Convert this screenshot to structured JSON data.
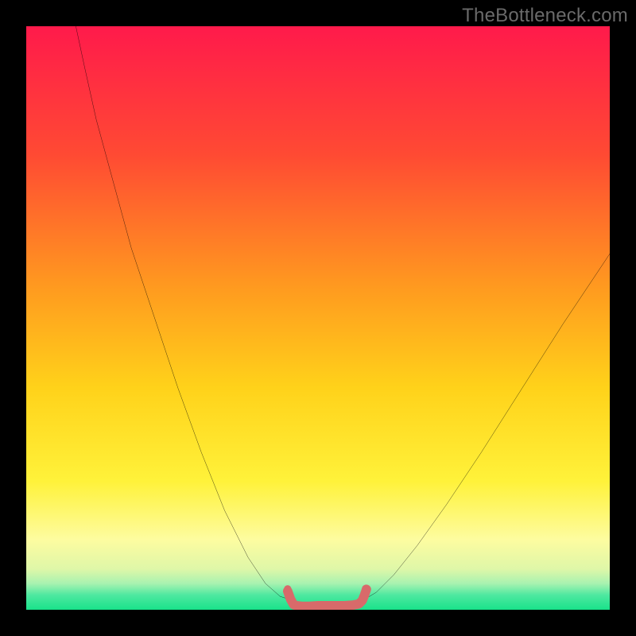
{
  "watermark": "TheBottleneck.com",
  "chart_data": {
    "type": "line",
    "title": "",
    "xlabel": "",
    "ylabel": "",
    "xlim": [
      0,
      100
    ],
    "ylim": [
      0,
      100
    ],
    "grid": false,
    "legend": false,
    "background_gradient_stops": [
      {
        "offset": 0.0,
        "color": "#ff1a4b"
      },
      {
        "offset": 0.22,
        "color": "#ff4a33"
      },
      {
        "offset": 0.45,
        "color": "#ff9b1f"
      },
      {
        "offset": 0.62,
        "color": "#ffd21a"
      },
      {
        "offset": 0.78,
        "color": "#fff23a"
      },
      {
        "offset": 0.88,
        "color": "#fdfca0"
      },
      {
        "offset": 0.93,
        "color": "#dff7a8"
      },
      {
        "offset": 0.955,
        "color": "#a8f2b0"
      },
      {
        "offset": 0.975,
        "color": "#4de8a0"
      },
      {
        "offset": 1.0,
        "color": "#19e28a"
      }
    ],
    "series": [
      {
        "name": "left-curve",
        "color": "#000000",
        "x": [
          8.5,
          10,
          12,
          15,
          18,
          22,
          26,
          30,
          34,
          38,
          41,
          43.5,
          45
        ],
        "y": [
          100,
          93,
          84,
          73,
          62,
          50,
          38,
          27,
          17,
          9,
          4.5,
          2.3,
          1.8
        ]
      },
      {
        "name": "right-curve",
        "color": "#000000",
        "x": [
          58,
          60,
          63,
          67,
          72,
          78,
          85,
          92,
          100
        ],
        "y": [
          1.8,
          3,
          6,
          11,
          18,
          27,
          38,
          49,
          61
        ]
      },
      {
        "name": "bottom-squiggle",
        "color": "#d86a6a",
        "x": [
          44.8,
          45.3,
          45.8,
          46.3,
          47.2,
          48.5,
          50,
          51.5,
          53,
          54.5,
          56,
          57,
          57.6,
          58,
          58.3
        ],
        "y": [
          3.2,
          1.8,
          0.9,
          0.7,
          0.6,
          0.6,
          0.7,
          0.7,
          0.7,
          0.7,
          0.8,
          1,
          1.6,
          2.6,
          3.5
        ]
      }
    ],
    "markers": [
      {
        "name": "left-dot",
        "x": 44.8,
        "y": 3.6,
        "color": "#d86a6a",
        "r": 4.5
      },
      {
        "name": "right-dot",
        "x": 58.2,
        "y": 3.6,
        "color": "#d86a6a",
        "r": 5
      }
    ]
  }
}
